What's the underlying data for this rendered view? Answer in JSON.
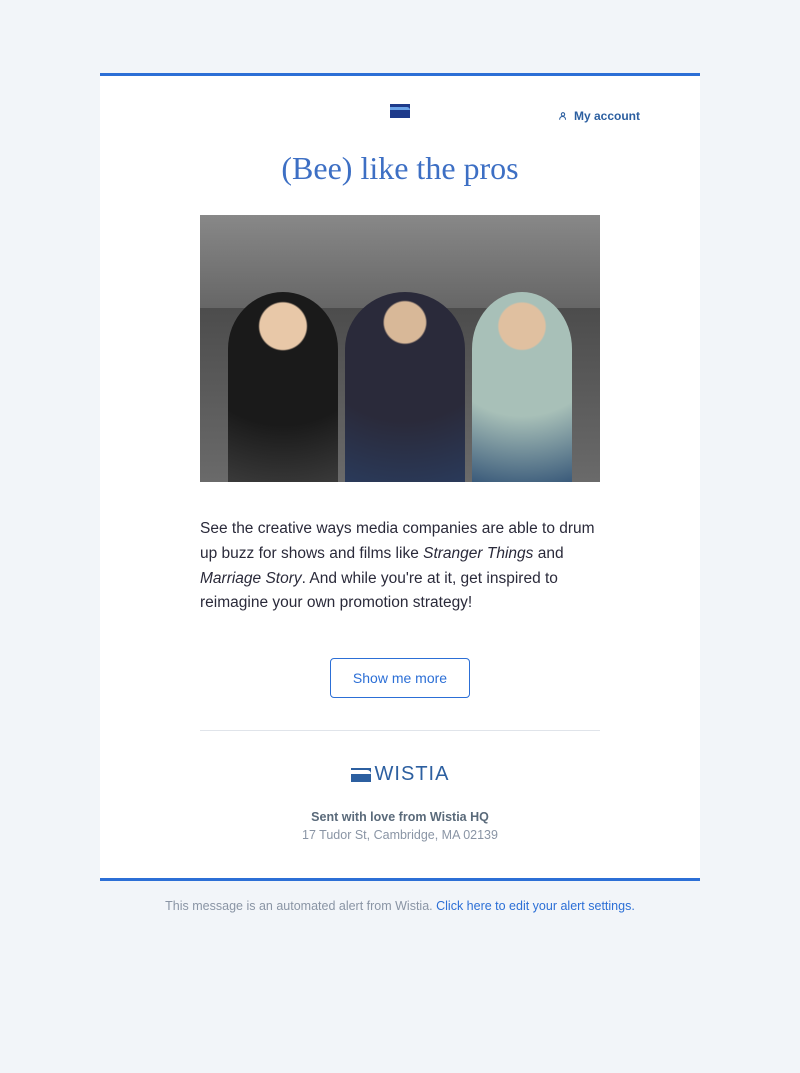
{
  "header": {
    "account_label": "My account"
  },
  "title": "(Bee) like the pros",
  "body": {
    "lead": "See the creative ways media companies are able to drum up buzz for shows and films like ",
    "italic1": "Stranger Things",
    "mid1": " and ",
    "italic2": "Marriage Story",
    "tail": ". And while you're at it, get inspired to reimagine your own promotion strategy!"
  },
  "cta": {
    "label": "Show me more"
  },
  "footer": {
    "brand": "WISTIA",
    "tagline": "Sent with love from Wistia HQ",
    "address": "17 Tudor St, Cambridge, MA 02139"
  },
  "alert": {
    "text": "This message is an automated alert from Wistia. ",
    "link": "Click here to edit your alert settings."
  }
}
